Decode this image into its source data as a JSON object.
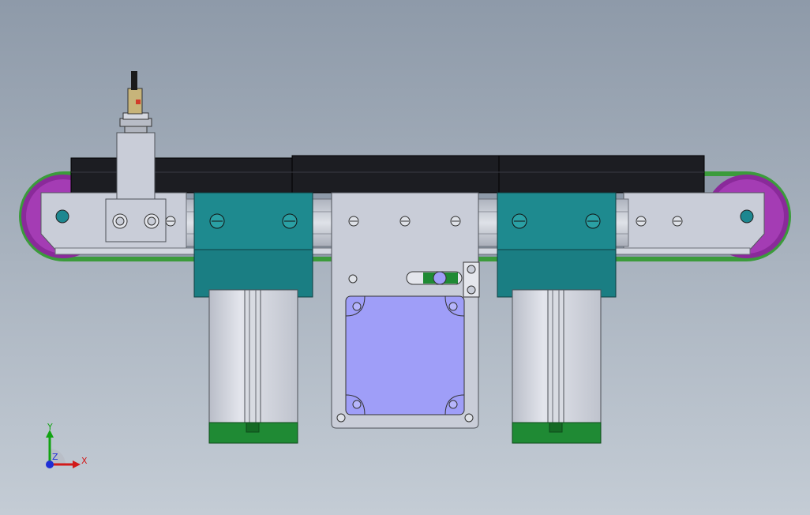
{
  "viewport": {
    "background_top": "#8e9aa9",
    "background_bottom": "#c4ccd5"
  },
  "model": {
    "belt_color": "#3b9b3b",
    "pulley_color": "#8a2a9a",
    "cover_color": "#1c1d22",
    "frame_color": "#c9cdd8",
    "block_color": "#1e8a8f",
    "cylinder_color": "#d0d3dc",
    "cylinder_cap_color": "#1f8a34",
    "motor_color": "#9f9ef8"
  },
  "triad": {
    "x_label": "X",
    "y_label": "Y",
    "z_label": "Z",
    "x_color": "#d11a1a",
    "y_color": "#12a312",
    "z_color": "#1f2fd6"
  }
}
